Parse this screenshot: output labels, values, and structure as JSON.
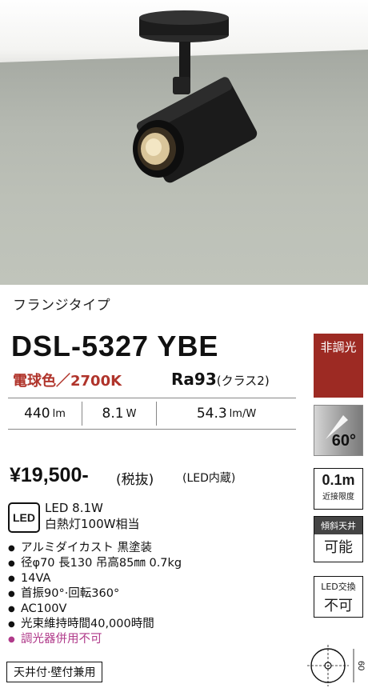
{
  "product": {
    "type_label": "フランジタイプ",
    "model": "DSL-5327 YBE",
    "color_temp": "電球色／2700K",
    "ra_value": "Ra93",
    "ra_class": "(クラス2)",
    "specs": [
      {
        "value": "440",
        "unit": "lm"
      },
      {
        "value": "8.1",
        "unit": "W"
      },
      {
        "value": "54.3",
        "unit": "lm/W"
      }
    ],
    "price": "¥19,500-",
    "price_tax": "(税抜)",
    "price_note": "(LED内蔵)",
    "led_badge": "LED",
    "led_line1": "LED 8.1W",
    "led_line2": "白熱灯100W相当",
    "features": [
      "アルミダイカスト 黒塗装",
      "径φ70 長130 吊高85㎜ 0.7kg",
      "14VA",
      "首振90°·回転360°",
      "AC100V",
      "光束維持時間40,000時間"
    ],
    "warning": "調光器併用不可",
    "mount": "天井付·壁付兼用"
  },
  "badges": {
    "non_dimmable": "非調光",
    "beam_angle": "60°",
    "distance_value": "0.1m",
    "distance_label": "近接限度",
    "tilt_label": "傾斜天井",
    "tilt_value": "可能",
    "led_exchange_label": "LED交換",
    "led_exchange_value": "不可",
    "dimension": "60"
  },
  "colors": {
    "accent_red": "#9d2a23",
    "warning_pink": "#b03a8a"
  }
}
